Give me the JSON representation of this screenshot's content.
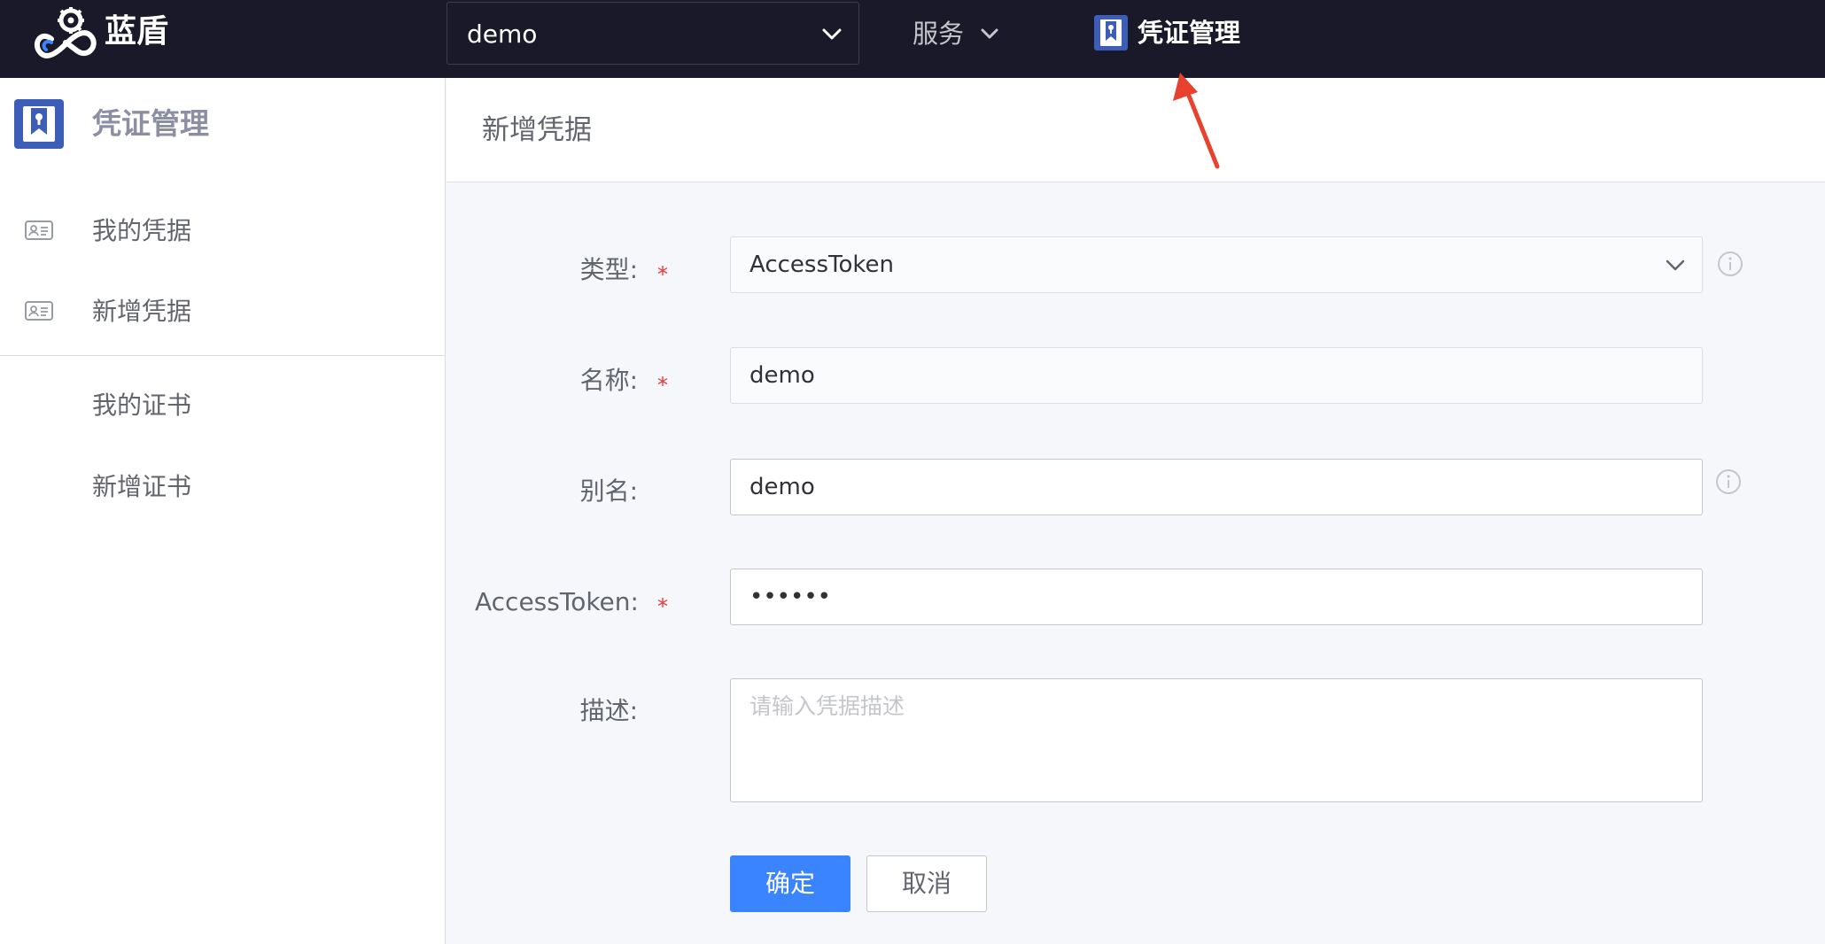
{
  "header": {
    "brand": "蓝盾",
    "project": {
      "value": "demo"
    },
    "nav": {
      "service_label": "服务",
      "credential_label": "凭证管理"
    }
  },
  "sidebar": {
    "title": "凭证管理",
    "items": [
      {
        "label": "我的凭据",
        "icon": "id-card-icon"
      },
      {
        "label": "新增凭据",
        "icon": "id-card-icon"
      },
      {
        "label": "我的证书"
      },
      {
        "label": "新增证书"
      }
    ]
  },
  "page": {
    "title": "新增凭据"
  },
  "form": {
    "type": {
      "label": "类型:",
      "value": "AccessToken"
    },
    "name": {
      "label": "名称:",
      "value": "demo"
    },
    "alias": {
      "label": "别名:",
      "value": "demo"
    },
    "token": {
      "label": "AccessToken:",
      "value": "••••••"
    },
    "description": {
      "label": "描述:",
      "placeholder": "请输入凭据描述"
    },
    "required_mark": "*"
  },
  "actions": {
    "confirm_label": "确定",
    "cancel_label": "取消"
  },
  "colors": {
    "topbar": "#191929",
    "primary": "#3a84ff",
    "required": "#ea3636",
    "annotation_arrow": "#e8422e",
    "credential_icon": "#3c5db8"
  }
}
